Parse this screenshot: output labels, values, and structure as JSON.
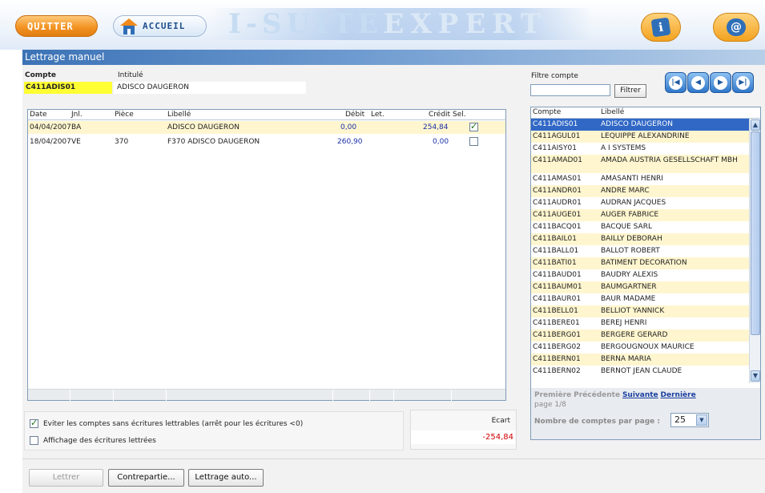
{
  "header": {
    "quit_label": "QUITTER",
    "home_label": "ACCUEIL",
    "brand_main": "I-SUITE",
    "brand_sub": "EXPERT",
    "accent": "#f39424"
  },
  "window": {
    "title": "Lettrage manuel"
  },
  "account": {
    "code_label": "Compte",
    "name_label": "Intitulé",
    "code": "C411ADIS01",
    "name": "ADISCO DAUGERON"
  },
  "grid": {
    "headers": {
      "date": "Date",
      "jnl": "Jnl.",
      "piece": "Pièce",
      "libelle": "Libellé",
      "debit": "Débit",
      "let": "Let.",
      "credit": "Crédit",
      "sel": "Sel."
    },
    "rows": [
      {
        "date": "04/04/2007",
        "jnl": "BA",
        "piece": "",
        "libelle": "ADISCO DAUGERON",
        "debit": "0,00",
        "let": "",
        "credit": "254,84",
        "selected": true
      },
      {
        "date": "18/04/2007",
        "jnl": "VE",
        "piece": "370",
        "libelle": "F370 ADISCO DAUGERON",
        "debit": "260,90",
        "let": "",
        "credit": "0,00",
        "selected": false
      }
    ]
  },
  "options": {
    "avoid_label": "Eviter les comptes sans écritures lettrables (arrêt pour les écritures <0)",
    "avoid_checked": true,
    "show_label": "Affichage des écritures lettrées",
    "show_checked": false
  },
  "ecart": {
    "label": "Ecart",
    "value": "-254,84"
  },
  "actions": {
    "lettrer": "Lettrer",
    "contrepartie": "Contrepartie...",
    "lettrage_auto": "Lettrage auto..."
  },
  "filter": {
    "label": "Filtre compte",
    "value": "",
    "button": "Filtrer"
  },
  "accounts": {
    "headers": {
      "compte": "Compte",
      "libelle": "Libellé"
    },
    "rows": [
      {
        "code": "C411ADIS01",
        "name": "ADISCO DAUGERON"
      },
      {
        "code": "C411AGUL01",
        "name": "LEQUIPPE ALEXANDRINE"
      },
      {
        "code": "C411AISY01",
        "name": "A I SYSTEMS"
      },
      {
        "code": "C411AMAD01",
        "name": "AMADA AUSTRIA GESELLSCHAFT MBH"
      },
      {
        "code": "C411AMAS01",
        "name": "AMASANTI HENRI"
      },
      {
        "code": "C411ANDR01",
        "name": "ANDRE MARC"
      },
      {
        "code": "C411AUDR01",
        "name": "AUDRAN JACQUES"
      },
      {
        "code": "C411AUGE01",
        "name": "AUGER FABRICE"
      },
      {
        "code": "C411BACQ01",
        "name": "BACQUE SARL"
      },
      {
        "code": "C411BAIL01",
        "name": "BAILLY DEBORAH"
      },
      {
        "code": "C411BALL01",
        "name": "BALLOT ROBERT"
      },
      {
        "code": "C411BATI01",
        "name": "BATIMENT DECORATION"
      },
      {
        "code": "C411BAUD01",
        "name": "BAUDRY ALEXIS"
      },
      {
        "code": "C411BAUM01",
        "name": "BAUMGARTNER"
      },
      {
        "code": "C411BAUR01",
        "name": "BAUR MADAME"
      },
      {
        "code": "C411BELL01",
        "name": "BELLIOT YANNICK"
      },
      {
        "code": "C411BERE01",
        "name": "BEREJ HENRI"
      },
      {
        "code": "C411BERG01",
        "name": "BERGERE GERARD"
      },
      {
        "code": "C411BERG02",
        "name": "BERGOUGNOUX MAURICE"
      },
      {
        "code": "C411BERN01",
        "name": "BERNA MARIA"
      },
      {
        "code": "C411BERN02",
        "name": "BERNOT JEAN CLAUDE"
      }
    ],
    "active_index": 0
  },
  "pager": {
    "first": "Première",
    "prev": "Précédente",
    "next": "Suivante",
    "last": "Dernière",
    "page_info": "page 1/8",
    "per_page_label": "Nombre de comptes par page :",
    "per_page": "25"
  }
}
